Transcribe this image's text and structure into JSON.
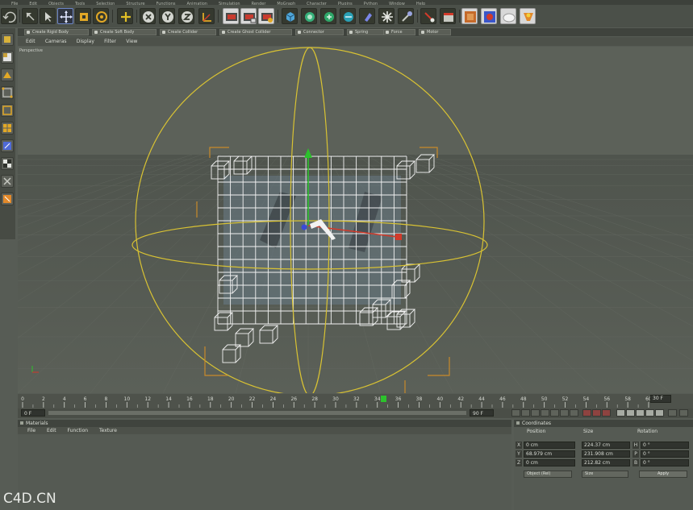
{
  "menubar": {
    "items": [
      "File",
      "Edit",
      "Objects",
      "Tools",
      "Selection",
      "Structure",
      "Functions",
      "Animation",
      "Simulation",
      "Render",
      "MoGraph",
      "Character",
      "Plugins",
      "Python",
      "Window",
      "Help"
    ]
  },
  "toolbar": {
    "icons": [
      "undo-icon",
      "live-selection-icon",
      "move-icon",
      "scale-icon",
      "rotate-icon",
      "add-object-icon",
      "x-axis-icon",
      "y-axis-icon",
      "z-axis-icon",
      "coordinate-system-icon",
      "render-view-icon",
      "render-picture-viewer-icon",
      "render-settings-icon",
      "cube-icon",
      "subdivision-icon",
      "array-icon",
      "modeling-icon",
      "deformer-icon",
      "light-icon",
      "camera-icon",
      "scene-icon",
      "material-icon",
      "floor-icon",
      "sky-icon",
      "light-bulb-icon"
    ]
  },
  "dynamics": {
    "buttons": [
      "Create Rigid Body",
      "Create Soft Body",
      "Create Collider",
      "Create Ghost Collider",
      "Connector",
      "Spring",
      "Force",
      "Motor"
    ]
  },
  "viewport": {
    "menu": [
      "Edit",
      "Cameras",
      "Display",
      "Filter",
      "View"
    ],
    "label": "Perspective"
  },
  "timeline": {
    "ticks": [
      "0",
      "2",
      "4",
      "6",
      "8",
      "10",
      "12",
      "14",
      "16",
      "18",
      "20",
      "22",
      "24",
      "26",
      "28",
      "30",
      "32",
      "34",
      "36",
      "38",
      "40",
      "42",
      "44",
      "46",
      "48",
      "50",
      "52",
      "54",
      "56",
      "58",
      "60"
    ],
    "current_frame": "36",
    "end_display": "30 F",
    "start_field": "0 F",
    "end_field": "90 F"
  },
  "materials": {
    "title": "Materials",
    "menu": [
      "File",
      "Edit",
      "Function",
      "Texture"
    ]
  },
  "coordinates": {
    "title": "Coordinates",
    "headers": [
      "Position",
      "Size",
      "Rotation"
    ],
    "rows": [
      {
        "axis": "X",
        "position": "0 cm",
        "size": "224.37 cm",
        "rot_label": "H",
        "rotation": "0 °"
      },
      {
        "axis": "Y",
        "position": "68.979 cm",
        "size": "231.908 cm",
        "rot_label": "P",
        "rotation": "0 °"
      },
      {
        "axis": "Z",
        "position": "0 cm",
        "size": "212.82 cm",
        "rot_label": "B",
        "rotation": "0 °"
      }
    ],
    "mode_dropdown": "Object (Rel)",
    "size_dropdown": "Size",
    "apply_label": "Apply"
  },
  "watermark": "C4D.CN",
  "colors": {
    "selection_yellow": "#d8c233",
    "axis_green": "#2cc22c",
    "axis_red": "#d23a2a",
    "axis_blue": "#3a4ad8",
    "wireframe": "#f2f2f2"
  }
}
